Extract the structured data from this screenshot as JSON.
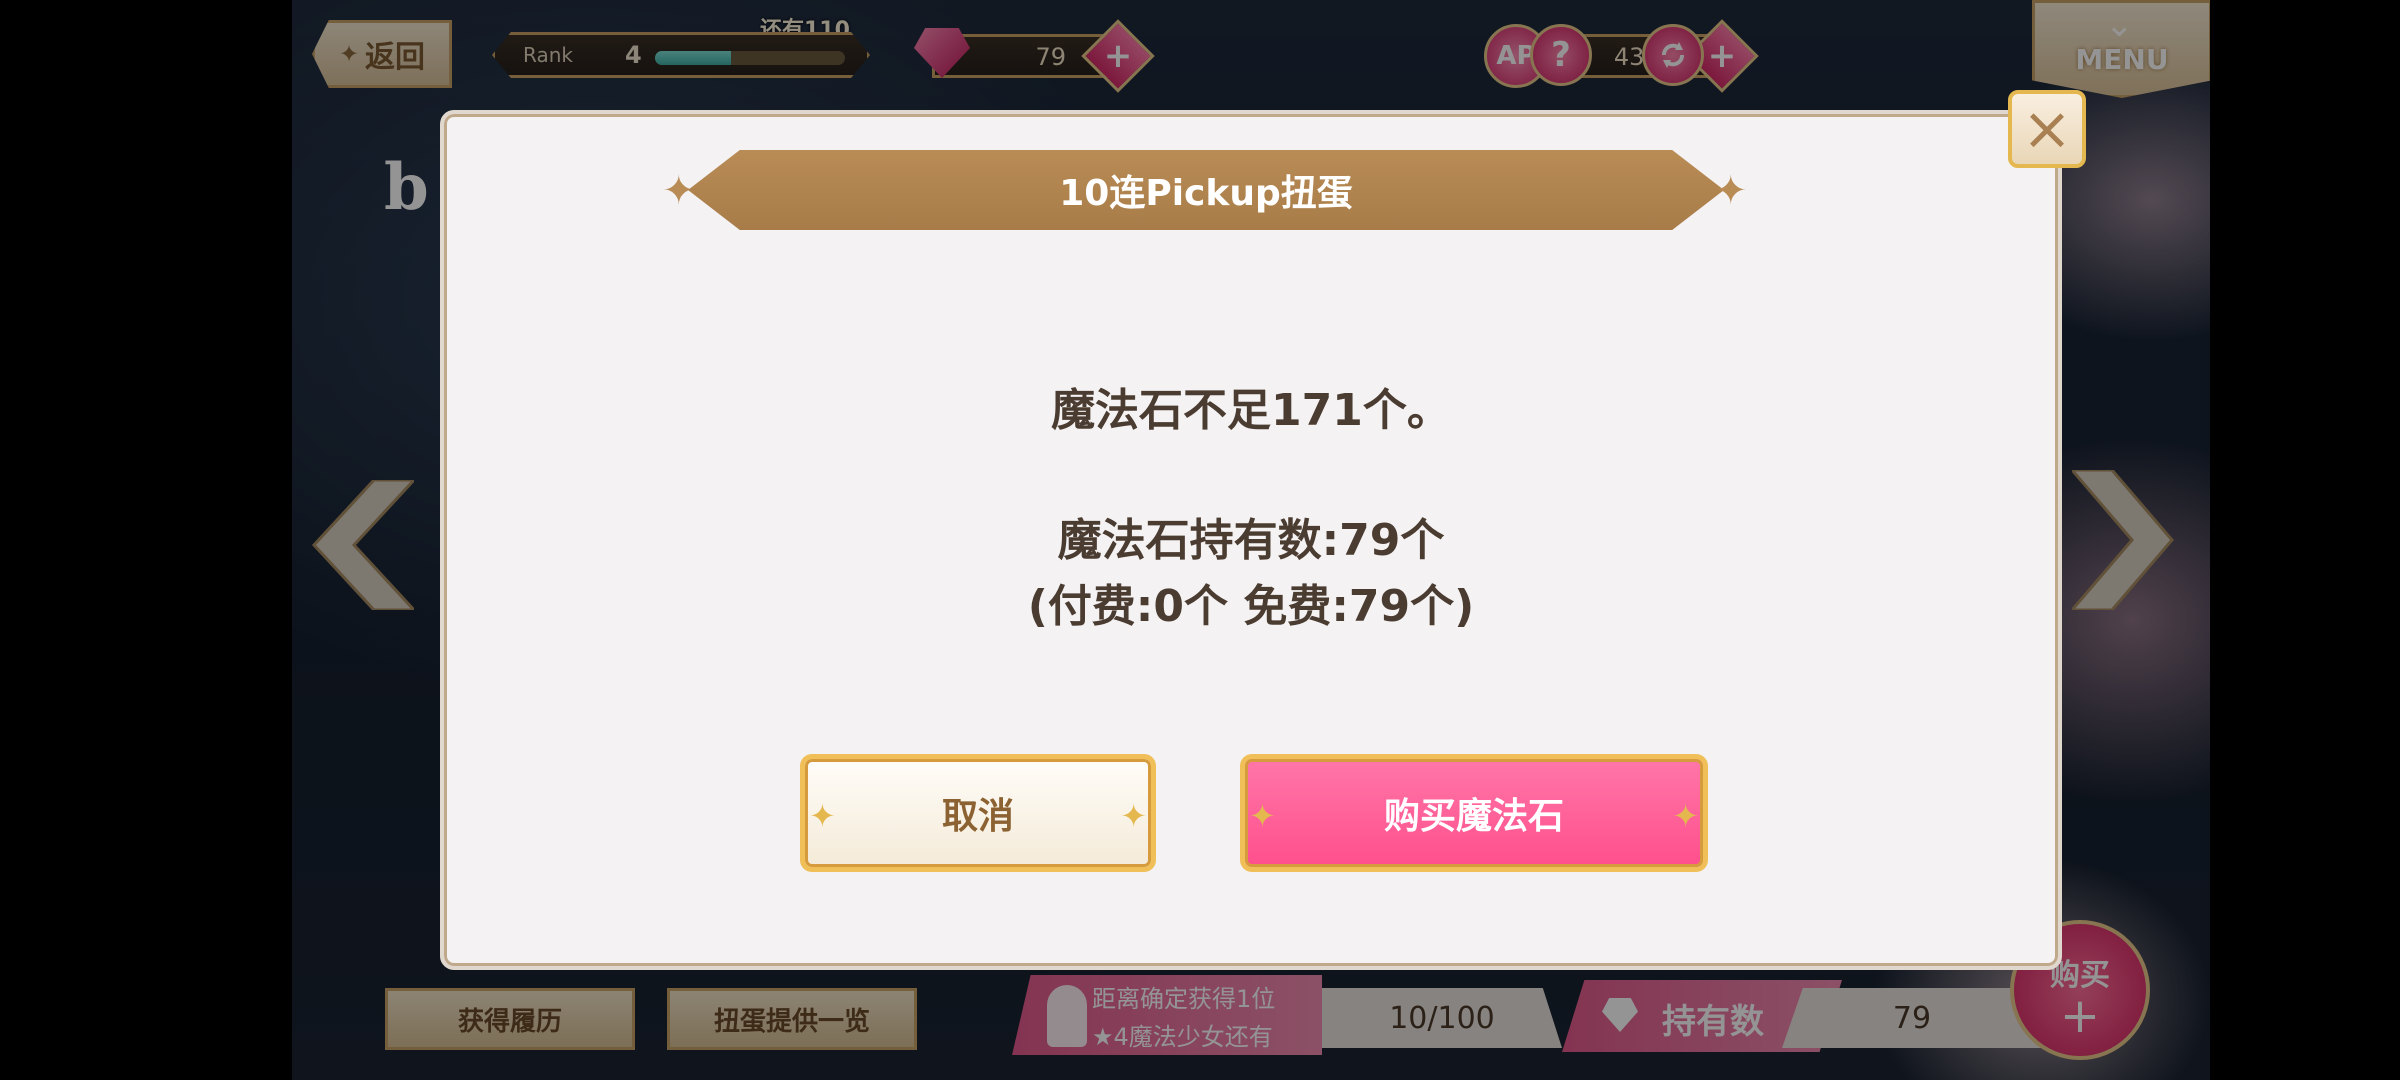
{
  "topbar": {
    "back_label": "返回",
    "rank_label": "Rank",
    "rank_value": "4",
    "rank_next": "还有110",
    "rank_progress": 0.4,
    "stones": "79",
    "ap_label": "AP",
    "ap_value": "43/23",
    "help": "?",
    "menu_label": "MENU"
  },
  "page_letter": "b",
  "dialog": {
    "title": "10连Pickup扭蛋",
    "message_line1": "魔法石不足171个。",
    "message_line2": "魔法石持有数:79个",
    "message_line3": "(付费:0个  免费:79个)",
    "cancel_label": "取消",
    "buy_label": "购买魔法石",
    "close_icon": "×"
  },
  "bottombar": {
    "history_label": "获得履历",
    "provide_label": "扭蛋提供一览",
    "guarantee_line1": "距离确定获得1位",
    "guarantee_line2": "★4魔法少女还有",
    "guarantee_count": "10/100",
    "holding_label": "持有数",
    "holding_count": "79",
    "buy_label": "购买",
    "buy_plus": "+"
  }
}
